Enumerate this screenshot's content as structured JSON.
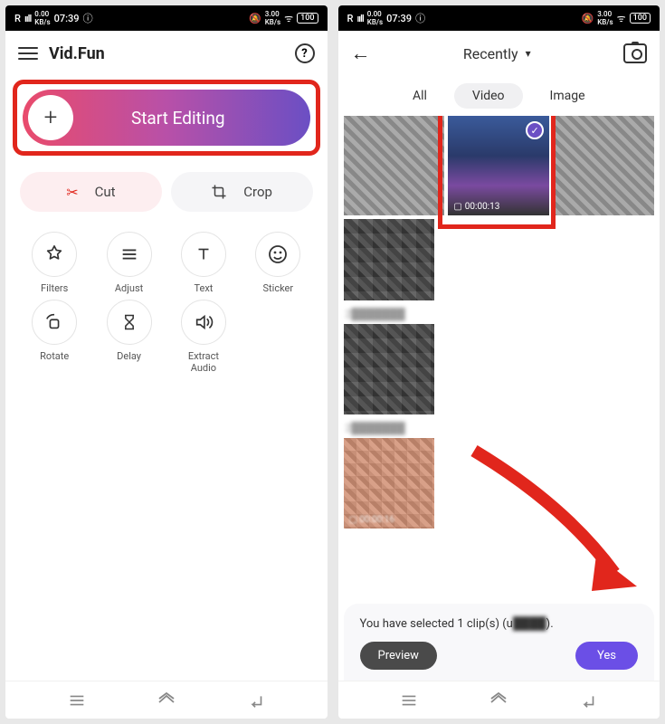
{
  "status": {
    "time": "07:39",
    "battery": "100"
  },
  "left": {
    "app_title": "Vid.Fun",
    "start_editing": "Start Editing",
    "cut": "Cut",
    "crop": "Crop",
    "tools": {
      "filters": "Filters",
      "adjust": "Adjust",
      "text": "Text",
      "sticker": "Sticker",
      "rotate": "Rotate",
      "delay": "Delay",
      "extract_audio": "Extract\nAudio"
    }
  },
  "right": {
    "gallery_title": "Recently",
    "tabs": {
      "all": "All",
      "video": "Video",
      "image": "Image"
    },
    "selected_duration": "00:00:13",
    "selection_text": "You have selected 1 clip(s) (u",
    "selection_text_end": ").",
    "preview": "Preview",
    "yes": "Yes"
  }
}
